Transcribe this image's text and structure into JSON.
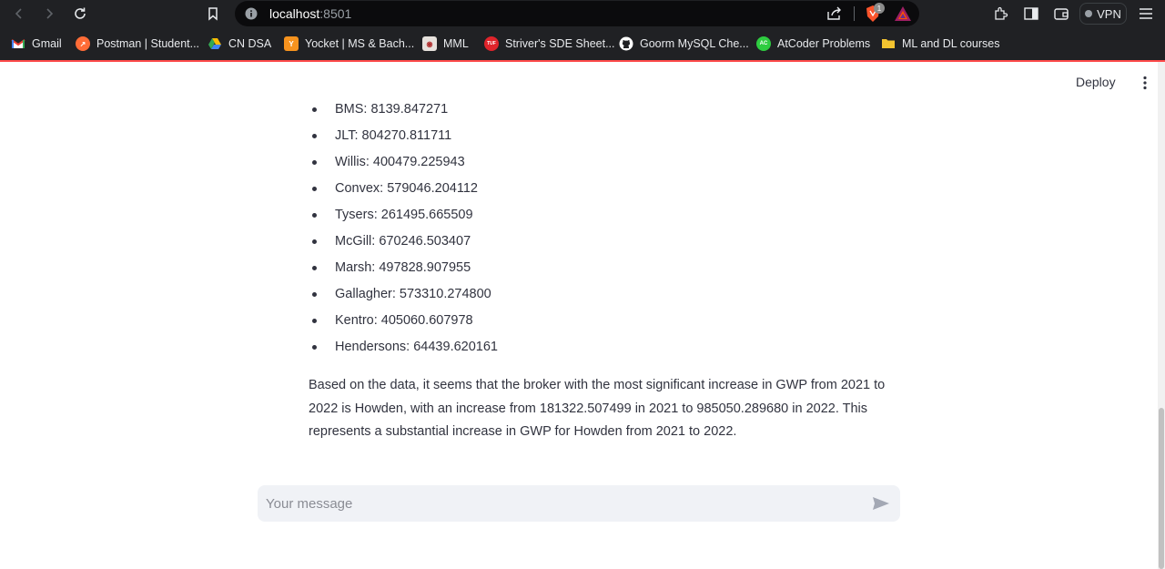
{
  "browser": {
    "url_host": "localhost",
    "url_port": ":8501",
    "brave_badge": "1",
    "vpn_label": "VPN"
  },
  "bookmarks": [
    {
      "label": "Gmail",
      "color": "#ea4335",
      "icon": "gmail-icon"
    },
    {
      "label": "Postman | Student...",
      "color": "#ff6c37",
      "icon": "postman-icon"
    },
    {
      "label": "CN DSA",
      "color": "#34a853",
      "icon": "google-drive-icon"
    },
    {
      "label": "Yocket | MS & Bach...",
      "color": "#f7931e",
      "icon": "yocket-icon"
    },
    {
      "label": "MML",
      "color": "#d9d9d9",
      "icon": "mml-icon"
    },
    {
      "label": "Striver's SDE Sheet...",
      "color": "#e0242b",
      "icon": "tuf-icon"
    },
    {
      "label": "Goorm MySQL Che...",
      "color": "#ffffff",
      "icon": "github-icon"
    },
    {
      "label": "AtCoder Problems",
      "color": "#2ecc40",
      "icon": "atcoder-icon"
    },
    {
      "label": "ML and DL courses",
      "color": "#f4c430",
      "icon": "folder-icon"
    }
  ],
  "app": {
    "deploy_label": "Deploy",
    "accent_color": "#ff4b4b"
  },
  "message": {
    "brokers": [
      "BMS: 8139.847271",
      "JLT: 804270.811711",
      "Willis: 400479.225943",
      "Convex: 579046.204112",
      "Tysers: 261495.665509",
      "McGill: 670246.503407",
      "Marsh: 497828.907955",
      "Gallagher: 573310.274800",
      "Kentro: 405060.607978",
      "Hendersons: 64439.620161"
    ],
    "summary": "Based on the data, it seems that the broker with the most significant increase in GWP from 2021 to 2022 is Howden, with an increase from 181322.507499 in 2021 to 985050.289680 in 2022. This represents a substantial increase in GWP for Howden from 2021 to 2022."
  },
  "chat": {
    "placeholder": "Your message"
  }
}
